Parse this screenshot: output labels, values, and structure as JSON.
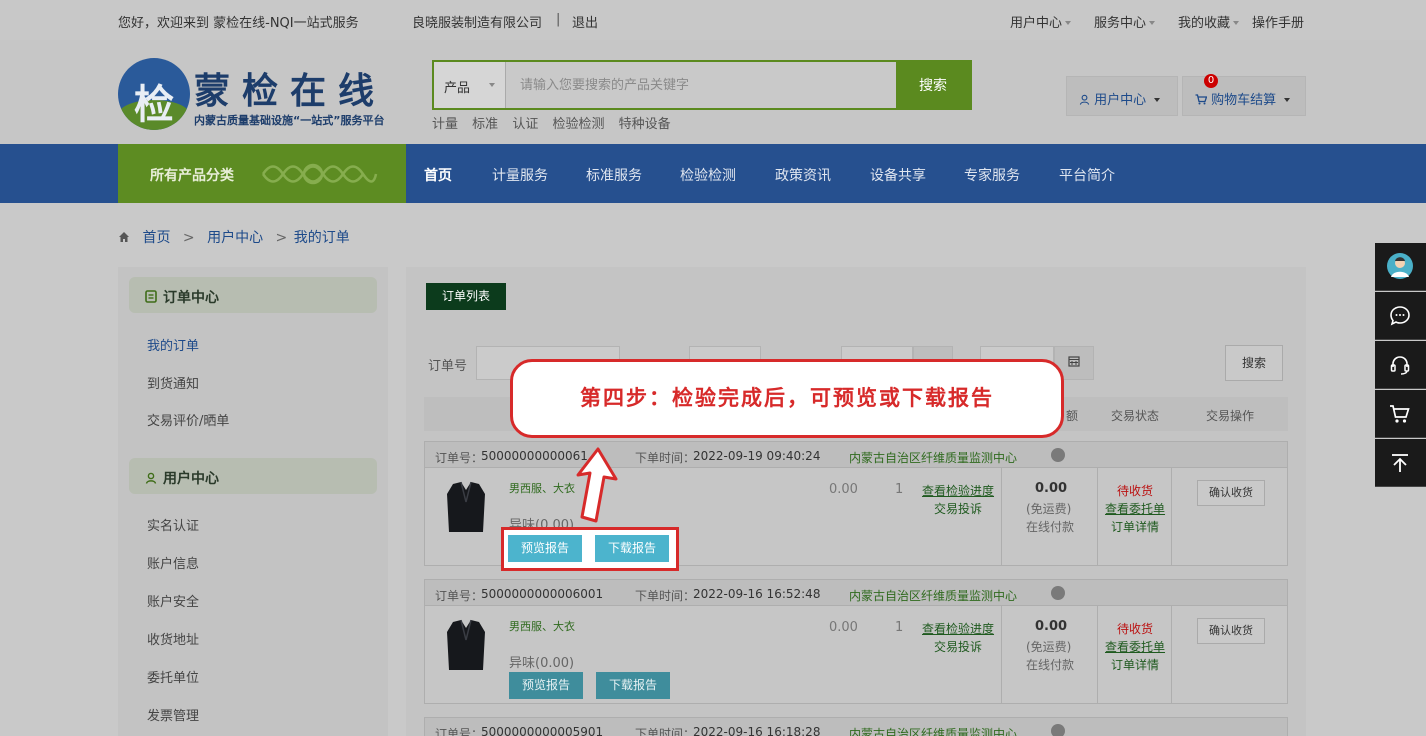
{
  "topbar": {
    "welcome": "您好，欢迎来到 蒙检在线-NQI一站式服务",
    "company": "良晓服装制造有限公司",
    "divider": "|",
    "logout": "退出",
    "user_center": "用户中心",
    "service_center": "服务中心",
    "favorites": "我的收藏",
    "manual": "操作手册"
  },
  "logo": {
    "emblem_char": "检",
    "title": "蒙检在线",
    "subtitle": "内蒙古质量基础设施“一站式”服务平台"
  },
  "search": {
    "category": "产品",
    "placeholder": "请输入您要搜索的产品关键字",
    "button": "搜索",
    "hot_keywords": [
      "计量",
      "标准",
      "认证",
      "检验检测",
      "特种设备"
    ]
  },
  "header_buttons": {
    "user_center": "用户中心",
    "cart": "购物车结算",
    "cart_count": "0"
  },
  "nav": {
    "all_categories": "所有产品分类",
    "items": [
      "首页",
      "计量服务",
      "标准服务",
      "检验检测",
      "政策资讯",
      "设备共享",
      "专家服务",
      "平台简介"
    ]
  },
  "breadcrumb": {
    "home": "首页",
    "sep": ">",
    "level2": "用户中心",
    "level3": "我的订单"
  },
  "sidebar": {
    "section1_title": "订单中心",
    "section1_items": [
      "我的订单",
      "到货通知",
      "交易评价/晒单"
    ],
    "section2_title": "用户中心",
    "section2_items": [
      "实名认证",
      "账户信息",
      "账户安全",
      "收货地址",
      "委托单位",
      "发票管理"
    ]
  },
  "main": {
    "tab": "订单列表",
    "filter_order_no": "订单号",
    "search_button": "搜索",
    "columns": [
      "额",
      "交易状态",
      "交易操作"
    ]
  },
  "orders": [
    {
      "order_no_label": "订单号：",
      "order_no": "50000000000061",
      "time_label": "下单时间：",
      "time": "2022-09-19 09:40:24",
      "shop": "内蒙古自治区纤维质量监测中心",
      "product": "男西服、大衣",
      "attr": "异味(0.00)",
      "price": "0.00",
      "qty": "1",
      "view_progress": "查看检验进度",
      "complaint": "交易投诉",
      "total": "0.00",
      "freight": "(免运费)",
      "pay": "在线付款",
      "status": "待收货",
      "view_entrust": "查看委托单",
      "detail": "订单详情",
      "confirm": "确认收货",
      "preview": "预览报告",
      "download": "下载报告"
    },
    {
      "order_no_label": "订单号：",
      "order_no": "5000000000006001",
      "time_label": "下单时间：",
      "time": "2022-09-16 16:52:48",
      "shop": "内蒙古自治区纤维质量监测中心",
      "product": "男西服、大衣",
      "attr": "异味(0.00)",
      "price": "0.00",
      "qty": "1",
      "view_progress": "查看检验进度",
      "complaint": "交易投诉",
      "total": "0.00",
      "freight": "(免运费)",
      "pay": "在线付款",
      "status": "待收货",
      "view_entrust": "查看委托单",
      "detail": "订单详情",
      "confirm": "确认收货",
      "preview": "预览报告",
      "download": "下载报告"
    },
    {
      "order_no_label": "订单号：",
      "order_no": "5000000000005901",
      "time_label": "下单时间：",
      "time": "2022-09-16 16:18:28",
      "shop": "内蒙古自治区纤维质量监测中心"
    }
  ],
  "callout": {
    "text": "第四步：检验完成后，可预览或下载报告"
  },
  "colors": {
    "brand_green": "#5b8a1f",
    "nav_blue": "#26508f",
    "highlight_red": "#d72a2a",
    "report_button": "#4cb4cd"
  },
  "right_toolbar": [
    "avatar-icon",
    "chat-icon",
    "headset-icon",
    "cart-icon",
    "back-to-top-icon"
  ]
}
